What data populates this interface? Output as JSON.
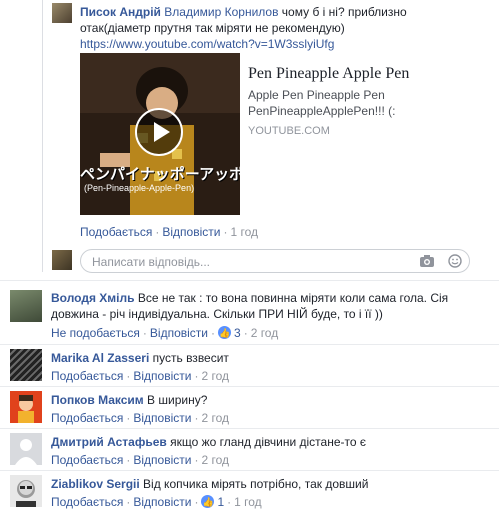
{
  "reply": {
    "author": "Писок Андрій",
    "mention": "Владимир Корнилов",
    "text_line1": " чому б і ні? приблизно",
    "text_line2": "отак(діаметр прутня так міряти не рекомендую)",
    "url": "https://www.youtube.com/watch?v=1W3sslyiUfg",
    "preview": {
      "title": "Pen Pineapple Apple Pen",
      "desc_line1": "Apple Pen Pineapple Pen",
      "desc_line2": "PenPineappleApplePen!!! (:",
      "domain": "YOUTUBE.COM",
      "thumb_caption": "ペンパイナッポーアッポー",
      "thumb_sub": "(Pen-Pineapple-Apple-Pen)"
    },
    "actions": {
      "like": "Подобається",
      "reply": "Відповісти",
      "time": "1 год"
    }
  },
  "reply_input": {
    "placeholder": "Написати відповідь..."
  },
  "comments": [
    {
      "author": "Володя Хміль",
      "text_line1": "Все не так : то вона повинна міряти коли сама гола. Сія",
      "text_line2": "довжина - річ індивідуальна. Скільки ПРИ НІЙ буде, то і її ))",
      "like": "Не подобається",
      "reply": "Відповісти",
      "likes": "3",
      "time": "2 год"
    },
    {
      "author": "Marika Al Zasseri",
      "text": "пусть взвесит",
      "like": "Подобається",
      "reply": "Відповісти",
      "time": "2 год"
    },
    {
      "author": "Попков Максим",
      "text": "В ширину?",
      "like": "Подобається",
      "reply": "Відповісти",
      "time": "2 год"
    },
    {
      "author": "Дмитрий Астафьев",
      "text": "якщо жо гланд дівчини дістане-то є",
      "like": "Подобається",
      "reply": "Відповісти",
      "time": "2 год"
    },
    {
      "author": "Ziablikov Sergii",
      "text": "Від копчика мірять потрібно, так довший",
      "like": "Подобається",
      "reply": "Відповісти",
      "likes": "1",
      "time": "1 год"
    }
  ]
}
